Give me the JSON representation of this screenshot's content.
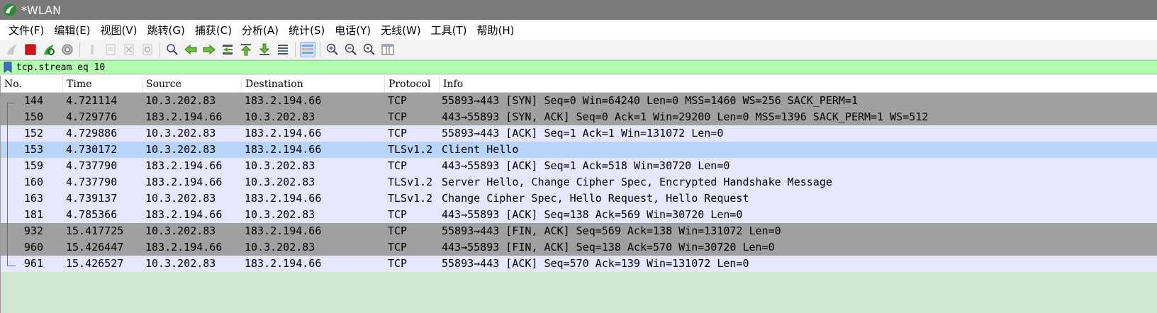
{
  "window": {
    "title": "*WLAN"
  },
  "menu": [
    "文件(F)",
    "编辑(E)",
    "视图(V)",
    "跳转(G)",
    "捕获(C)",
    "分析(A)",
    "统计(S)",
    "电话(Y)",
    "无线(W)",
    "工具(T)",
    "帮助(H)"
  ],
  "toolbar": {
    "buttons": [
      {
        "name": "start-capture-icon",
        "state": "disabled"
      },
      {
        "name": "stop-capture-icon",
        "state": "normal"
      },
      {
        "name": "restart-capture-icon",
        "state": "normal"
      },
      {
        "name": "capture-options-icon",
        "state": "normal"
      },
      {
        "name": "open-file-icon",
        "state": "disabled"
      },
      {
        "name": "save-file-icon",
        "state": "disabled"
      },
      {
        "name": "close-file-icon",
        "state": "disabled"
      },
      {
        "name": "reload-file-icon",
        "state": "disabled"
      },
      {
        "name": "find-packet-icon",
        "state": "normal"
      },
      {
        "name": "go-back-icon",
        "state": "normal"
      },
      {
        "name": "go-forward-icon",
        "state": "normal"
      },
      {
        "name": "go-to-packet-icon",
        "state": "normal"
      },
      {
        "name": "go-first-icon",
        "state": "normal"
      },
      {
        "name": "go-last-icon",
        "state": "normal"
      },
      {
        "name": "auto-scroll-icon",
        "state": "normal"
      },
      {
        "name": "colorize-icon",
        "state": "pressed"
      },
      {
        "name": "zoom-in-icon",
        "state": "normal"
      },
      {
        "name": "zoom-out-icon",
        "state": "normal"
      },
      {
        "name": "zoom-reset-icon",
        "state": "normal"
      },
      {
        "name": "resize-columns-icon",
        "state": "normal"
      }
    ]
  },
  "filter": {
    "value": "tcp.stream eq 10"
  },
  "columns": [
    "No.",
    "Time",
    "Source",
    "Destination",
    "Protocol",
    "Info"
  ],
  "colors": {
    "grey_row": "#a0a0a0",
    "normal_row": "#e7e6ff",
    "selected_row": "#b8d4fb",
    "filter_bg": "#afffaf",
    "list_empty_bg": "#cfe7cf"
  },
  "packets": [
    {
      "no": "144",
      "time": "4.721114",
      "src": "10.3.202.83",
      "dst": "183.2.194.66",
      "proto": "TCP",
      "info": "55893→443 [SYN] Seq=0 Win=64240 Len=0 MSS=1460 WS=256 SACK_PERM=1",
      "style": "grey"
    },
    {
      "no": "150",
      "time": "4.729776",
      "src": "183.2.194.66",
      "dst": "10.3.202.83",
      "proto": "TCP",
      "info": "443→55893 [SYN, ACK] Seq=0 Ack=1 Win=29200 Len=0 MSS=1396 SACK_PERM=1 WS=512",
      "style": "grey"
    },
    {
      "no": "152",
      "time": "4.729886",
      "src": "10.3.202.83",
      "dst": "183.2.194.66",
      "proto": "TCP",
      "info": "55893→443 [ACK] Seq=1 Ack=1 Win=131072 Len=0",
      "style": "normal"
    },
    {
      "no": "153",
      "time": "4.730172",
      "src": "10.3.202.83",
      "dst": "183.2.194.66",
      "proto": "TLSv1.2",
      "info": "Client Hello",
      "style": "selected"
    },
    {
      "no": "159",
      "time": "4.737790",
      "src": "183.2.194.66",
      "dst": "10.3.202.83",
      "proto": "TCP",
      "info": "443→55893 [ACK] Seq=1 Ack=518 Win=30720 Len=0",
      "style": "normal"
    },
    {
      "no": "160",
      "time": "4.737790",
      "src": "183.2.194.66",
      "dst": "10.3.202.83",
      "proto": "TLSv1.2",
      "info": "Server Hello, Change Cipher Spec, Encrypted Handshake Message",
      "style": "normal"
    },
    {
      "no": "163",
      "time": "4.739137",
      "src": "10.3.202.83",
      "dst": "183.2.194.66",
      "proto": "TLSv1.2",
      "info": "Change Cipher Spec, Hello Request, Hello Request",
      "style": "normal"
    },
    {
      "no": "181",
      "time": "4.785366",
      "src": "183.2.194.66",
      "dst": "10.3.202.83",
      "proto": "TCP",
      "info": "443→55893 [ACK] Seq=138 Ack=569 Win=30720 Len=0",
      "style": "normal"
    },
    {
      "no": "932",
      "time": "15.417725",
      "src": "10.3.202.83",
      "dst": "183.2.194.66",
      "proto": "TCP",
      "info": "55893→443 [FIN, ACK] Seq=569 Ack=138 Win=131072 Len=0",
      "style": "grey"
    },
    {
      "no": "960",
      "time": "15.426447",
      "src": "183.2.194.66",
      "dst": "10.3.202.83",
      "proto": "TCP",
      "info": "443→55893 [FIN, ACK] Seq=138 Ack=570 Win=30720 Len=0",
      "style": "grey"
    },
    {
      "no": "961",
      "time": "15.426527",
      "src": "10.3.202.83",
      "dst": "183.2.194.66",
      "proto": "TCP",
      "info": "55893→443 [ACK] Seq=570 Ack=139 Win=131072 Len=0",
      "style": "normal"
    }
  ]
}
